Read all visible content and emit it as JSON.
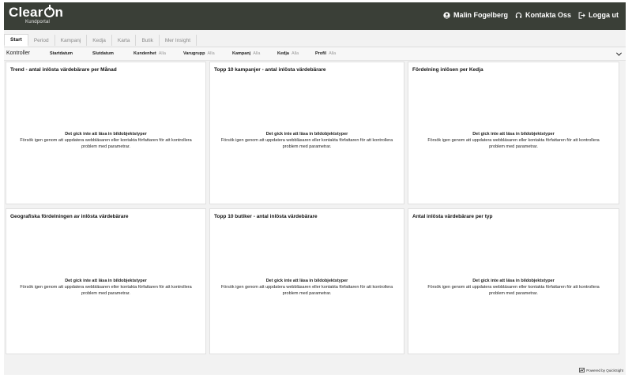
{
  "header": {
    "logo_text_pre": "Clear",
    "logo_text_post": "n",
    "logo_sub": "Kundportal",
    "user_name": "Malin Fogelberg",
    "contact_label": "Kontakta Oss",
    "logout_label": "Logga ut"
  },
  "tabs": [
    {
      "label": "Start",
      "active": true
    },
    {
      "label": "Period"
    },
    {
      "label": "Kampanj"
    },
    {
      "label": "Kedja"
    },
    {
      "label": "Karta"
    },
    {
      "label": "Butik"
    },
    {
      "label": "Mer Insight"
    }
  ],
  "controls": {
    "title": "Kontroller",
    "items": [
      {
        "label": "Startdatum",
        "value": ""
      },
      {
        "label": "Slutdatum",
        "value": ""
      },
      {
        "label": "Kundenhet",
        "value": "Alla"
      },
      {
        "label": "Varugrupp",
        "value": "Alla"
      },
      {
        "label": "Kampanj",
        "value": "Alla"
      },
      {
        "label": "Kedja",
        "value": "Alla"
      },
      {
        "label": "Profil",
        "value": "Alla"
      }
    ]
  },
  "error": {
    "title": "Det gick inte att läsa in bildobjektstyper",
    "body": "Försök igen genom att uppdatera webbläsaren eller kontakta författaren för att kontrollera problem med parametrar."
  },
  "cards": [
    {
      "title": "Trend - antal inlösta värdebärare per Månad"
    },
    {
      "title": "Topp 10 kampanjer - antal inlösta värdebärare"
    },
    {
      "title": "Fördelning inlösen per Kedja"
    },
    {
      "title": "Geografiska fördelningen av inlösta värdebärare"
    },
    {
      "title": "Topp 10 butiker - antal inlösta värdebärare"
    },
    {
      "title": "Antal inlösta värdebärare per typ"
    }
  ],
  "footer": {
    "powered_by": "Powered by QuickSight"
  },
  "colors": {
    "header_bg": "#3a3f37",
    "page_bg": "#f2f2f2",
    "card_bg": "#ffffff"
  }
}
